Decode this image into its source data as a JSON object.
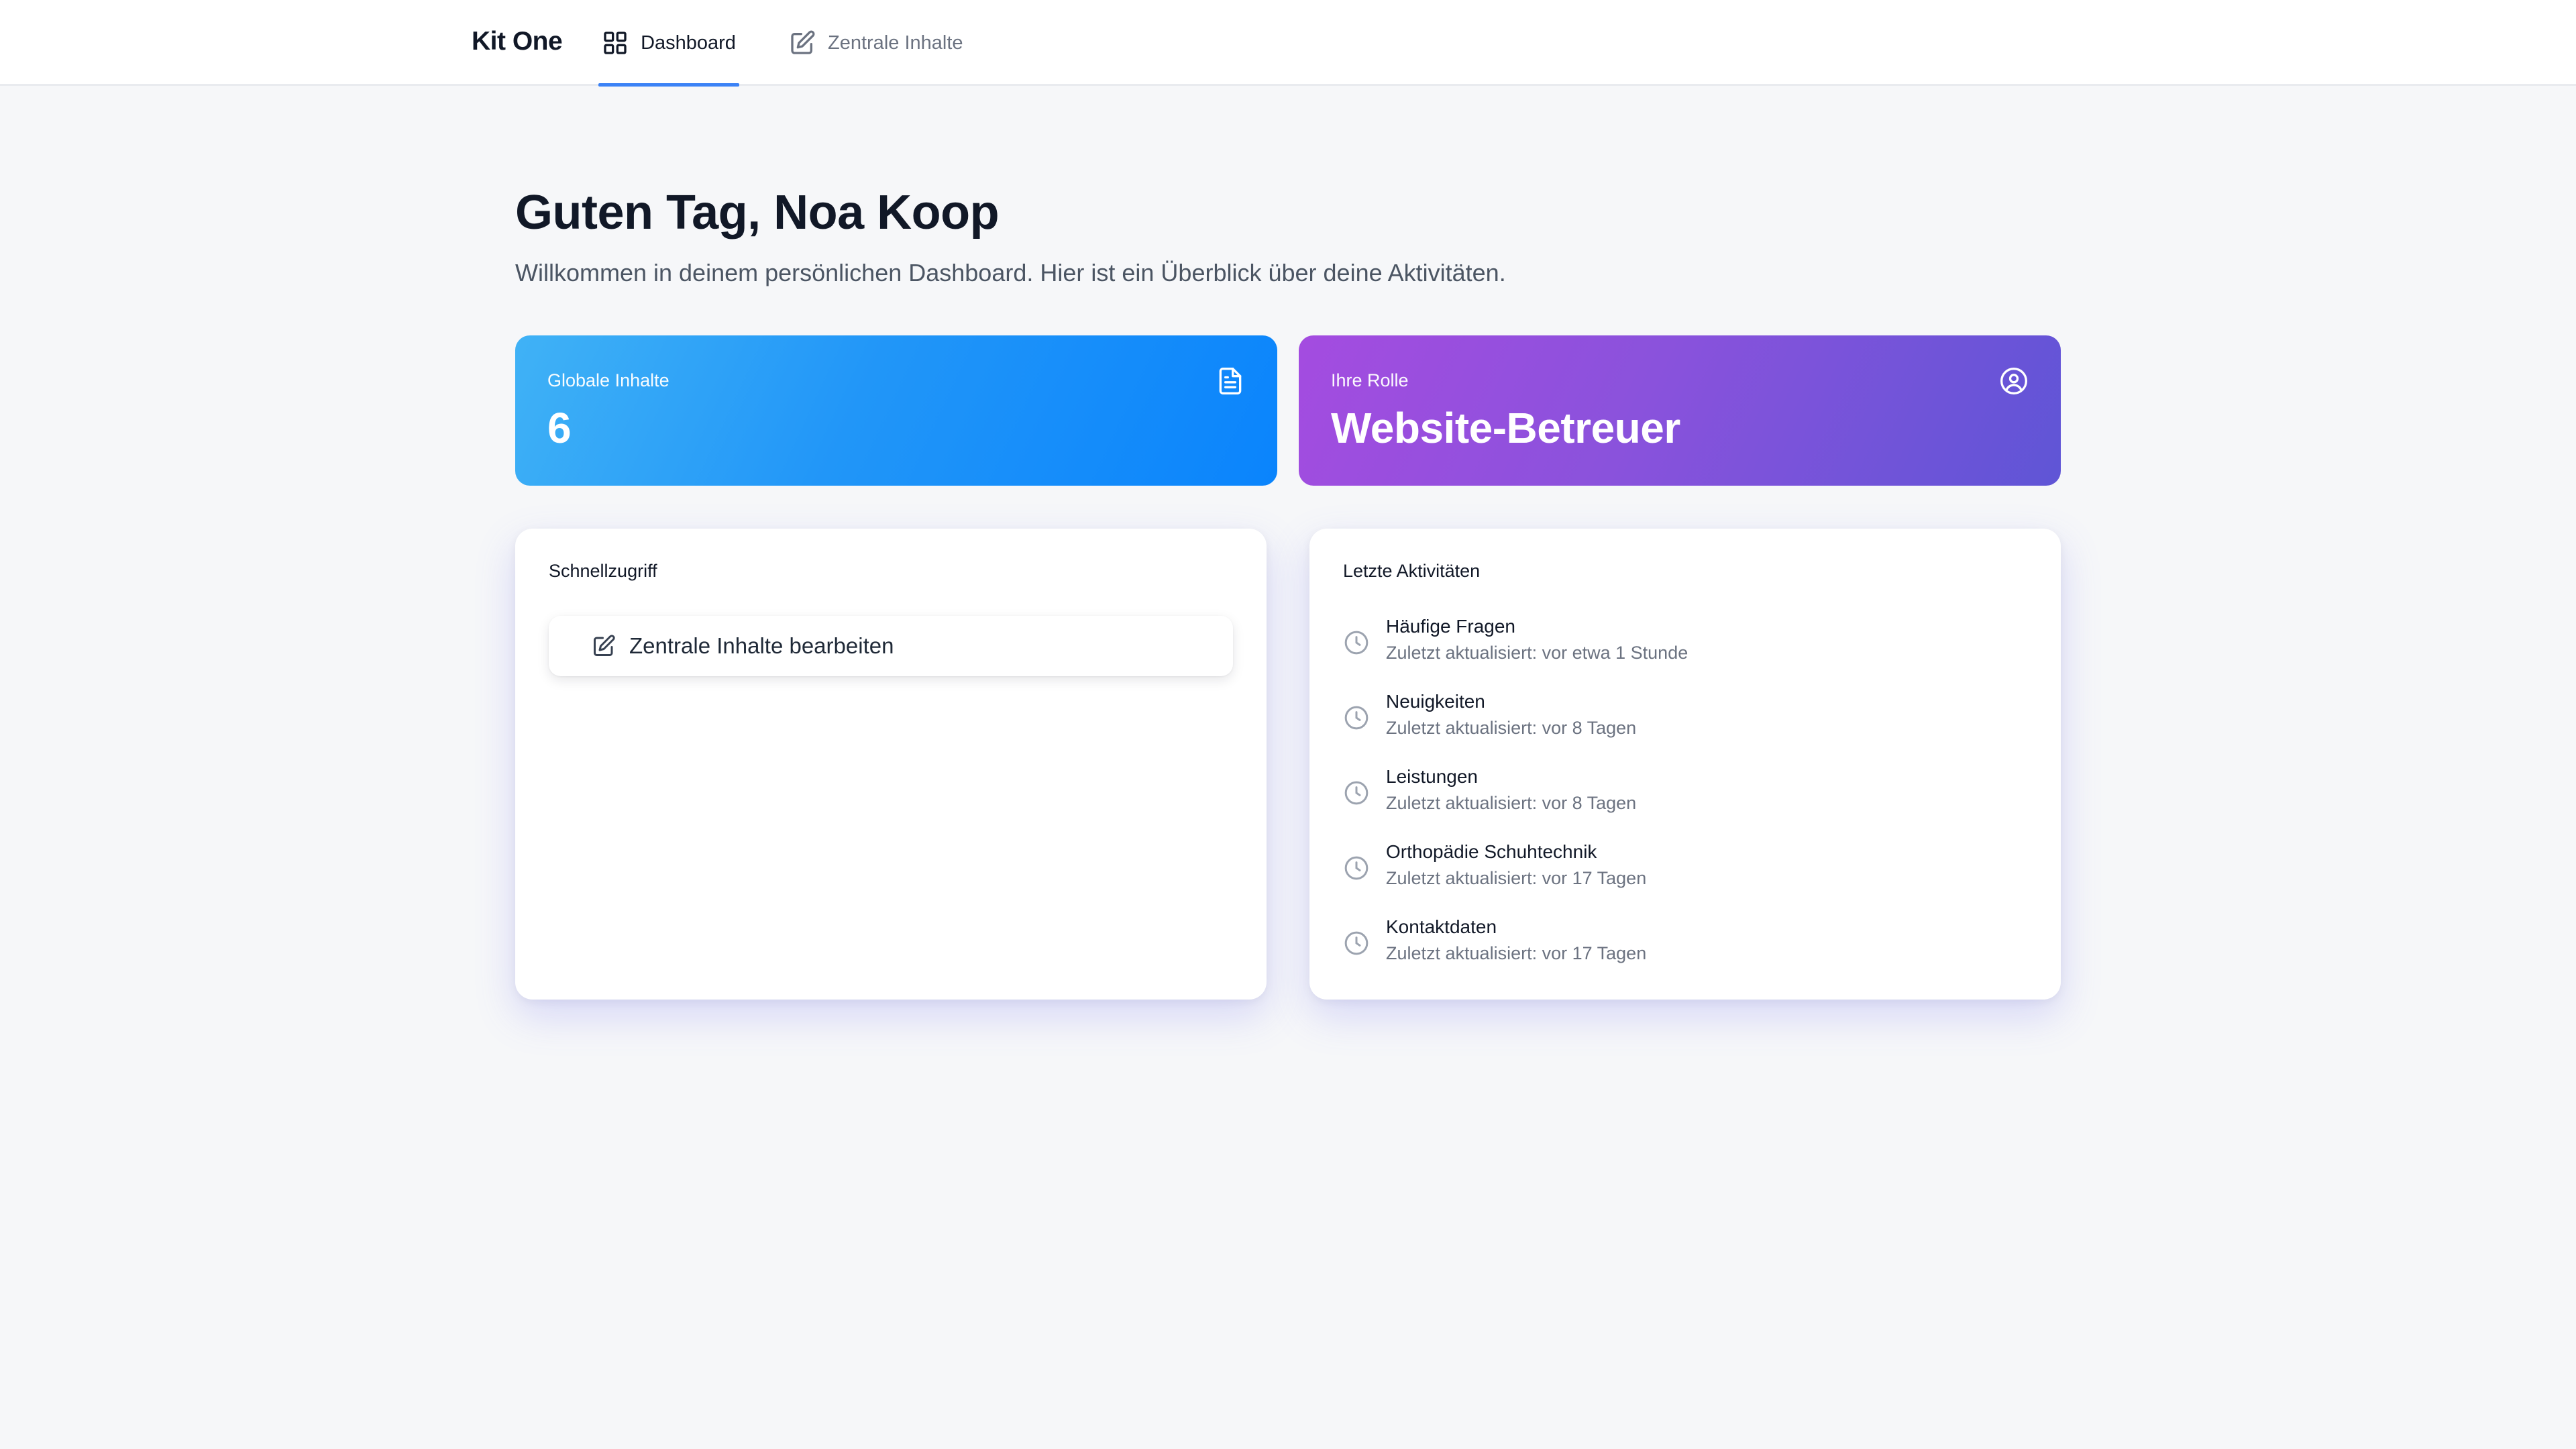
{
  "header": {
    "brand": "Kit One",
    "tabs": [
      {
        "label": "Dashboard",
        "icon": "grid-icon",
        "active": true
      },
      {
        "label": "Zentrale Inhalte",
        "icon": "edit-icon",
        "active": false
      }
    ],
    "accent_color": "#3b82f6"
  },
  "main": {
    "greeting": "Guten Tag, Noa Koop",
    "subtitle": "Willkommen in deinem persönlichen Dashboard. Hier ist ein Überblick über deine Aktivitäten.",
    "stats": [
      {
        "label": "Globale Inhalte",
        "value": "6",
        "icon": "document-icon",
        "color_from": "#40b2f6",
        "color_to": "#0a84fc"
      },
      {
        "label": "Ihre Rolle",
        "value": "Website-Betreuer",
        "icon": "user-circle-icon",
        "color_from": "#a44ce0",
        "color_to": "#5f55d6"
      }
    ],
    "quick_access": {
      "title": "Schnellzugriff",
      "actions": [
        {
          "label": "Zentrale Inhalte bearbeiten",
          "icon": "edit-icon"
        }
      ]
    },
    "recent_activity": {
      "title": "Letzte Aktivitäten",
      "items": [
        {
          "title": "Häufige Fragen",
          "meta": "Zuletzt aktualisiert: vor etwa 1 Stunde"
        },
        {
          "title": "Neuigkeiten",
          "meta": "Zuletzt aktualisiert: vor 8 Tagen"
        },
        {
          "title": "Leistungen",
          "meta": "Zuletzt aktualisiert: vor 8 Tagen"
        },
        {
          "title": "Orthopädie Schuhtechnik",
          "meta": "Zuletzt aktualisiert: vor 17 Tagen"
        },
        {
          "title": "Kontaktdaten",
          "meta": "Zuletzt aktualisiert: vor 17 Tagen"
        }
      ]
    }
  }
}
